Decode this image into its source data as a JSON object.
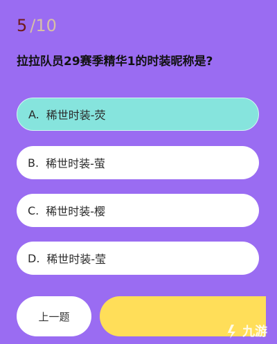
{
  "progress": {
    "current": "5",
    "total": "/10"
  },
  "question": "拉拉队员29赛季精华1的时装昵称是?",
  "options": [
    {
      "letter": "A.",
      "text": "稀世时装-荧",
      "selected": true
    },
    {
      "letter": "B.",
      "text": "稀世时装-萤",
      "selected": false
    },
    {
      "letter": "C.",
      "text": "稀世时装-樱",
      "selected": false
    },
    {
      "letter": "D.",
      "text": "稀世时装-莹",
      "selected": false
    }
  ],
  "buttons": {
    "prev_label": "上一题",
    "next_label": ""
  },
  "watermark": {
    "text": "九游",
    "icon": "jiuyou-logo-icon"
  },
  "colors": {
    "background": "#9a6cf2",
    "option_selected": "#86e4dd",
    "option_default": "#ffffff",
    "next_button": "#ffde59",
    "progress_current": "#6e1a1a",
    "progress_total": "#d7c0a6"
  }
}
